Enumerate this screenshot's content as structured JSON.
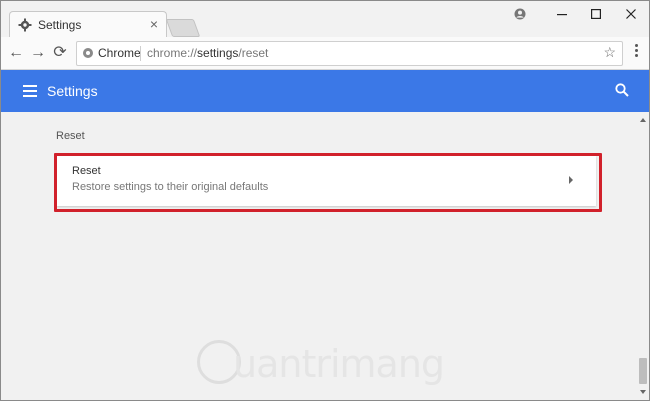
{
  "tab": {
    "title": "Settings",
    "icon": "gear-icon",
    "close": "×"
  },
  "window_controls": {
    "profile": "profile-icon",
    "minimize": "minimize-icon",
    "maximize": "maximize-icon",
    "close": "close-icon"
  },
  "toolbar": {
    "back": "←",
    "forward": "→",
    "reload": "⟳",
    "site_chip": "Chrome",
    "url_scheme": "chrome://",
    "url_path": "settings",
    "url_rest": "/reset",
    "star": "☆"
  },
  "header": {
    "title": "Settings"
  },
  "content": {
    "section_title": "Reset",
    "card": {
      "title": "Reset",
      "subtitle": "Restore settings to their original defaults"
    }
  },
  "watermark": {
    "text": "uantrimang"
  },
  "colors": {
    "accent": "#3b78e7",
    "highlight": "#d1212b"
  }
}
